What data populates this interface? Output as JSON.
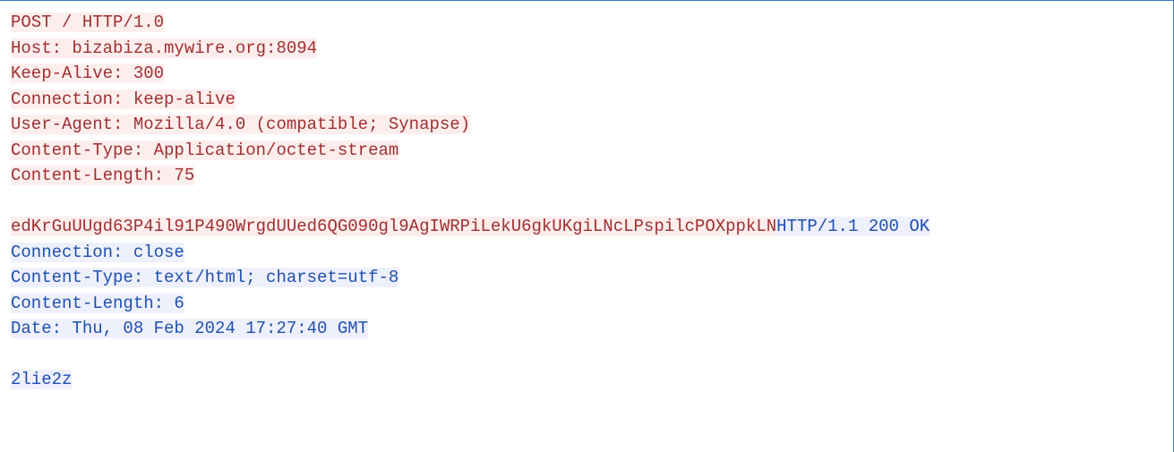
{
  "http_stream": {
    "request": {
      "request_line": "POST / HTTP/1.0",
      "headers": {
        "host": "Host: bizabiza.mywire.org:8094",
        "keep_alive": "Keep-Alive: 300",
        "connection": "Connection: keep-alive",
        "user_agent": "User-Agent: Mozilla/4.0 (compatible; Synapse)",
        "content_type": "Content-Type: Application/octet-stream",
        "content_length": "Content-Length: 75"
      },
      "body": "edKrGuUUgd63P4il91P490WrgdUUed6QG090gl9AgIWRPiLekU6gkUKgiLNcLPspilcPOXppkLN"
    },
    "response": {
      "status_line": "HTTP/1.1 200 OK",
      "headers": {
        "connection": "Connection: close",
        "content_type": "Content-Type: text/html; charset=utf-8",
        "content_length": "Content-Length: 6",
        "date": "Date: Thu, 08 Feb 2024 17:27:40 GMT"
      },
      "body": "2lie2z"
    }
  }
}
